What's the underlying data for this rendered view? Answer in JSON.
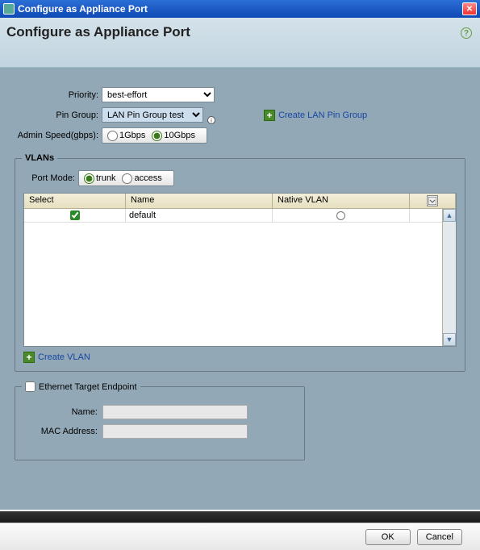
{
  "window": {
    "title": "Configure as Appliance Port"
  },
  "header": {
    "title": "Configure as Appliance Port"
  },
  "form": {
    "priority": {
      "label": "Priority:",
      "value": "best-effort"
    },
    "pin_group": {
      "label": "Pin Group:",
      "value": "LAN Pin Group test"
    },
    "create_lan_pin_group": "Create LAN Pin Group",
    "admin_speed": {
      "label": "Admin Speed(gbps):",
      "options": [
        "1Gbps",
        "10Gbps"
      ],
      "selected": "10Gbps"
    }
  },
  "vlans": {
    "legend": "VLANs",
    "port_mode": {
      "label": "Port Mode:",
      "options": [
        "trunk",
        "access"
      ],
      "selected": "trunk"
    },
    "columns": {
      "select": "Select",
      "name": "Name",
      "native": "Native VLAN"
    },
    "rows": [
      {
        "selected": true,
        "name": "default",
        "native": false
      }
    ],
    "create_vlan": "Create VLAN"
  },
  "eth": {
    "legend": "Ethernet Target Endpoint",
    "enabled": false,
    "name": {
      "label": "Name:",
      "value": ""
    },
    "mac": {
      "label": "MAC Address:",
      "value": ""
    }
  },
  "footer": {
    "ok": "OK",
    "cancel": "Cancel"
  }
}
